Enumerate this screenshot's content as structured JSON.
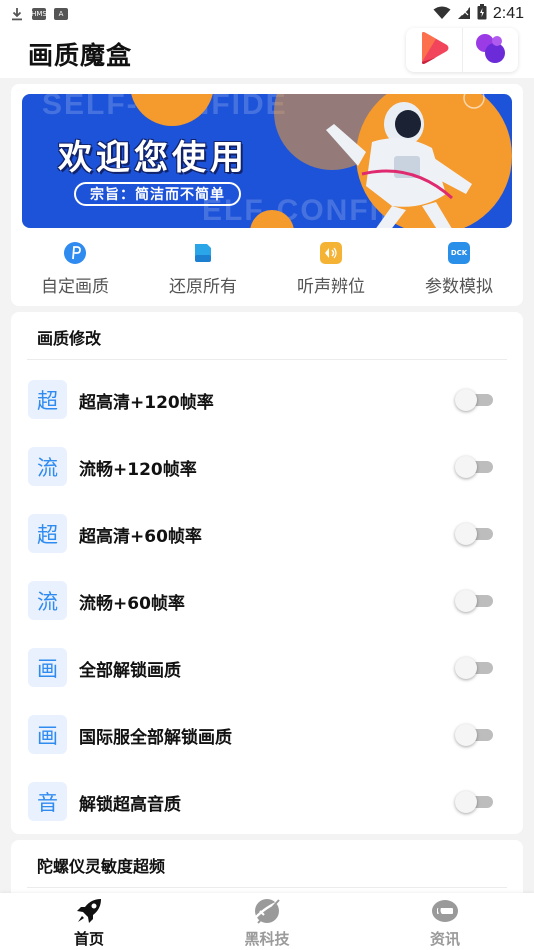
{
  "status_bar": {
    "time": "2:41",
    "left_icons": [
      "download-icon",
      "hms-icon",
      "a-icon"
    ],
    "box_hms": "HMS",
    "box_a": "A"
  },
  "header": {
    "title": "画质魔盒"
  },
  "banner": {
    "title": "欢迎您使用",
    "slogan": "宗旨：简洁而不简单",
    "bg_text_1": "SELF-CONFIDE",
    "bg_text_2": "ELF-CONFIDENC"
  },
  "quick_actions": [
    {
      "label": "自定画质",
      "icon": "p-icon",
      "color": "#2f8bf0",
      "glyph": "P"
    },
    {
      "label": "还原所有",
      "icon": "restore-icon",
      "color": "#2aa6e8",
      "glyph": ""
    },
    {
      "label": "听声辨位",
      "icon": "sound-icon",
      "color": "#f5b335",
      "glyph": ""
    },
    {
      "label": "参数模拟",
      "icon": "dck-icon",
      "color": "#2a8fe8",
      "glyph": "DCK"
    }
  ],
  "quality_section": {
    "title": "画质修改",
    "items": [
      {
        "badge": "超",
        "label": "超高清+120帧率",
        "enabled": false
      },
      {
        "badge": "流",
        "label": "流畅+120帧率",
        "enabled": false
      },
      {
        "badge": "超",
        "label": "超高清+60帧率",
        "enabled": false
      },
      {
        "badge": "流",
        "label": "流畅+60帧率",
        "enabled": false
      },
      {
        "badge": "画",
        "label": "全部解锁画质",
        "enabled": false
      },
      {
        "badge": "画",
        "label": "国际服全部解锁画质",
        "enabled": false
      },
      {
        "badge": "音",
        "label": "解锁超高音质",
        "enabled": false
      }
    ]
  },
  "gyro_section": {
    "title": "陀螺仪灵敏度超频"
  },
  "bottom_nav": [
    {
      "label": "首页",
      "icon": "rocket-icon",
      "active": true
    },
    {
      "label": "黑科技",
      "icon": "planet-icon",
      "active": false
    },
    {
      "label": "资讯",
      "icon": "news-icon",
      "active": false
    }
  ],
  "colors": {
    "accent": "#2f8bf0",
    "banner": "#1d53d8",
    "toggle_off": "#bdbdbd"
  }
}
